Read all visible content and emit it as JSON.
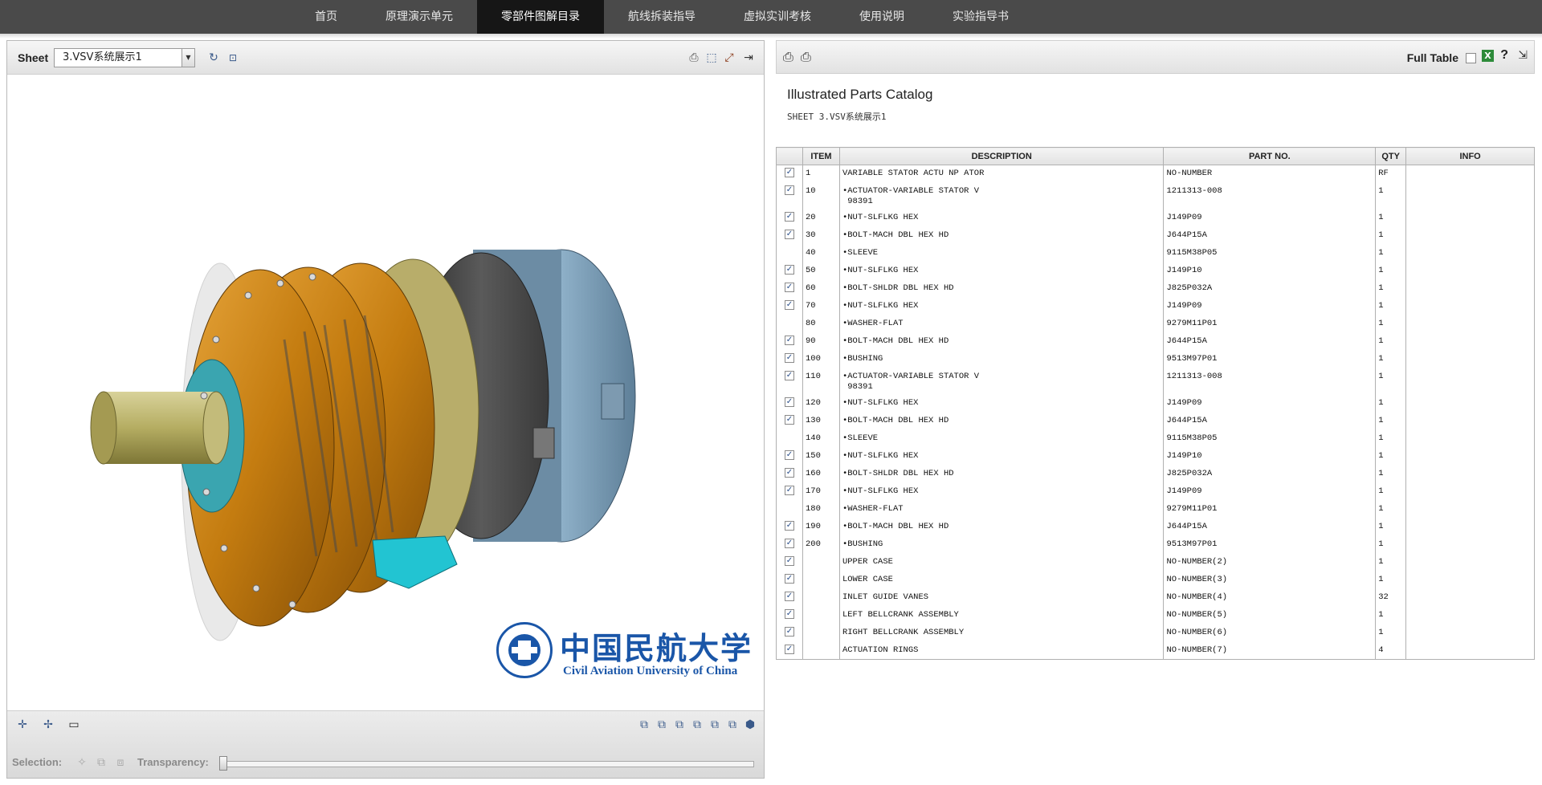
{
  "nav": {
    "items": [
      "首页",
      "原理演示单元",
      "零部件图解目录",
      "航线拆装指导",
      "虚拟实训考核",
      "使用说明",
      "实验指导书"
    ],
    "active_index": 2
  },
  "viewer": {
    "sheet_label": "Sheet",
    "sheet_value": "3.VSV系统展示1",
    "logo": {
      "chinese": "中国民航大学",
      "english": "Civil Aviation University of China"
    },
    "selection_label": "Selection:",
    "transparency_label": "Transparency:",
    "transparency_value": 0
  },
  "catalog": {
    "full_table_label": "Full Table",
    "help": "?",
    "title": "Illustrated Parts Catalog",
    "sheet_line": "SHEET 3.VSV系统展示1",
    "columns": [
      "",
      "ITEM",
      "DESCRIPTION",
      "PART NO.",
      "QTY",
      "INFO"
    ],
    "rows": [
      {
        "checked": true,
        "item": "1",
        "desc": "VARIABLE STATOR ACTU NP  ATOR",
        "desc2": "",
        "part": "NO-NUMBER",
        "qty": "RF",
        "info": ""
      },
      {
        "checked": true,
        "item": "10",
        "desc": "•ACTUATOR-VARIABLE STATOR V",
        "desc2": " 98391",
        "part": "1211313-008",
        "qty": "1",
        "info": ""
      },
      {
        "checked": true,
        "item": "20",
        "desc": "•NUT-SLFLKG HEX",
        "desc2": "",
        "part": "J149P09",
        "qty": "1",
        "info": ""
      },
      {
        "checked": true,
        "item": "30",
        "desc": "•BOLT-MACH DBL HEX HD",
        "desc2": "",
        "part": "J644P15A",
        "qty": "1",
        "info": ""
      },
      {
        "checked": false,
        "item": "40",
        "desc": "•SLEEVE",
        "desc2": "",
        "part": "9115M38P05",
        "qty": "1",
        "info": ""
      },
      {
        "checked": true,
        "item": "50",
        "desc": "•NUT-SLFLKG HEX",
        "desc2": "",
        "part": "J149P10",
        "qty": "1",
        "info": ""
      },
      {
        "checked": true,
        "item": "60",
        "desc": "•BOLT-SHLDR DBL HEX HD",
        "desc2": "",
        "part": "J825P032A",
        "qty": "1",
        "info": ""
      },
      {
        "checked": true,
        "item": "70",
        "desc": "•NUT-SLFLKG HEX",
        "desc2": "",
        "part": "J149P09",
        "qty": "1",
        "info": ""
      },
      {
        "checked": false,
        "item": "80",
        "desc": "•WASHER-FLAT",
        "desc2": "",
        "part": "9279M11P01",
        "qty": "1",
        "info": ""
      },
      {
        "checked": true,
        "item": "90",
        "desc": "•BOLT-MACH DBL HEX HD",
        "desc2": "",
        "part": "J644P15A",
        "qty": "1",
        "info": ""
      },
      {
        "checked": true,
        "item": "100",
        "desc": "•BUSHING",
        "desc2": "",
        "part": "9513M97P01",
        "qty": "1",
        "info": ""
      },
      {
        "checked": true,
        "item": "110",
        "desc": "•ACTUATOR-VARIABLE STATOR V",
        "desc2": " 98391",
        "part": "1211313-008",
        "qty": "1",
        "info": ""
      },
      {
        "checked": true,
        "item": "120",
        "desc": "•NUT-SLFLKG HEX",
        "desc2": "",
        "part": "J149P09",
        "qty": "1",
        "info": ""
      },
      {
        "checked": true,
        "item": "130",
        "desc": "•BOLT-MACH DBL HEX HD",
        "desc2": "",
        "part": "J644P15A",
        "qty": "1",
        "info": ""
      },
      {
        "checked": false,
        "item": "140",
        "desc": "•SLEEVE",
        "desc2": "",
        "part": "9115M38P05",
        "qty": "1",
        "info": ""
      },
      {
        "checked": true,
        "item": "150",
        "desc": "•NUT-SLFLKG HEX",
        "desc2": "",
        "part": "J149P10",
        "qty": "1",
        "info": ""
      },
      {
        "checked": true,
        "item": "160",
        "desc": "•BOLT-SHLDR DBL HEX HD",
        "desc2": "",
        "part": "J825P032A",
        "qty": "1",
        "info": ""
      },
      {
        "checked": true,
        "item": "170",
        "desc": "•NUT-SLFLKG HEX",
        "desc2": "",
        "part": "J149P09",
        "qty": "1",
        "info": ""
      },
      {
        "checked": false,
        "item": "180",
        "desc": "•WASHER-FLAT",
        "desc2": "",
        "part": "9279M11P01",
        "qty": "1",
        "info": ""
      },
      {
        "checked": true,
        "item": "190",
        "desc": "•BOLT-MACH DBL HEX HD",
        "desc2": "",
        "part": "J644P15A",
        "qty": "1",
        "info": ""
      },
      {
        "checked": true,
        "item": "200",
        "desc": "•BUSHING",
        "desc2": "",
        "part": "9513M97P01",
        "qty": "1",
        "info": ""
      },
      {
        "checked": true,
        "item": "",
        "desc": "UPPER CASE",
        "desc2": "",
        "part": "NO-NUMBER(2)",
        "qty": "1",
        "info": ""
      },
      {
        "checked": true,
        "item": "",
        "desc": "LOWER CASE",
        "desc2": "",
        "part": "NO-NUMBER(3)",
        "qty": "1",
        "info": ""
      },
      {
        "checked": true,
        "item": "",
        "desc": "INLET GUIDE VANES",
        "desc2": "",
        "part": "NO-NUMBER(4)",
        "qty": "32",
        "info": ""
      },
      {
        "checked": true,
        "item": "",
        "desc": "LEFT BELLCRANK ASSEMBLY",
        "desc2": "",
        "part": "NO-NUMBER(5)",
        "qty": "1",
        "info": ""
      },
      {
        "checked": true,
        "item": "",
        "desc": "RIGHT BELLCRANK ASSEMBLY",
        "desc2": "",
        "part": "NO-NUMBER(6)",
        "qty": "1",
        "info": ""
      },
      {
        "checked": true,
        "item": "",
        "desc": "ACTUATION RINGS",
        "desc2": "",
        "part": "NO-NUMBER(7)",
        "qty": "4",
        "info": ""
      }
    ]
  },
  "colors": {
    "nav_bg": "#4a4a4a",
    "nav_active": "#161616",
    "logo_blue": "#1a56a8",
    "engine_orange": "#c8820e",
    "engine_blue": "#6f93ad"
  }
}
